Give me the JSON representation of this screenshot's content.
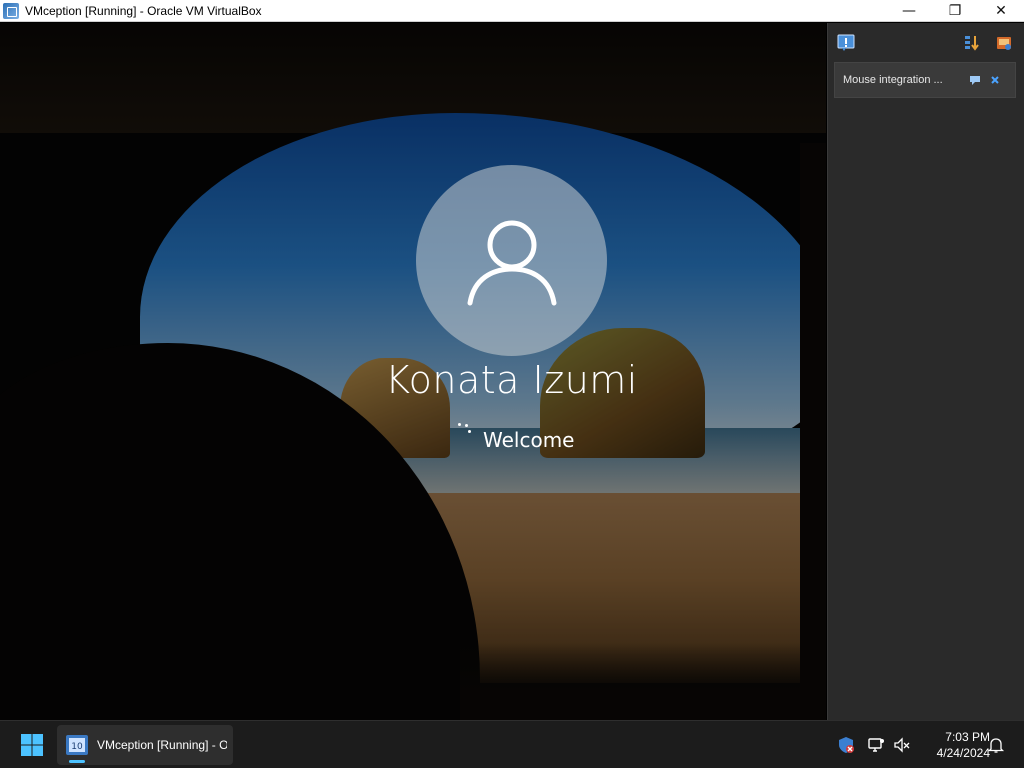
{
  "window": {
    "title": "VMception [Running] - Oracle VM VirtualBox",
    "minimize_glyph": "—",
    "restore_glyph": "❐",
    "close_glyph": "✕"
  },
  "login": {
    "user_name": "Konata Izumi",
    "status": "Welcome"
  },
  "notifications": {
    "items": [
      {
        "text": "Mouse integration ..."
      }
    ]
  },
  "taskbar": {
    "task_label": "VMception [Running] - Oracle VM VirtualBox",
    "time": "7:03 PM",
    "date": "4/24/2024"
  },
  "icons": {
    "start": "windows-start-icon",
    "notification_center": "notification-center-icon",
    "sort": "sort-icon",
    "settings": "notification-settings-icon"
  },
  "colors": {
    "accent": "#4cc2ff",
    "taskbar": "#1c1c1c",
    "panel": "#2a2a2a"
  }
}
